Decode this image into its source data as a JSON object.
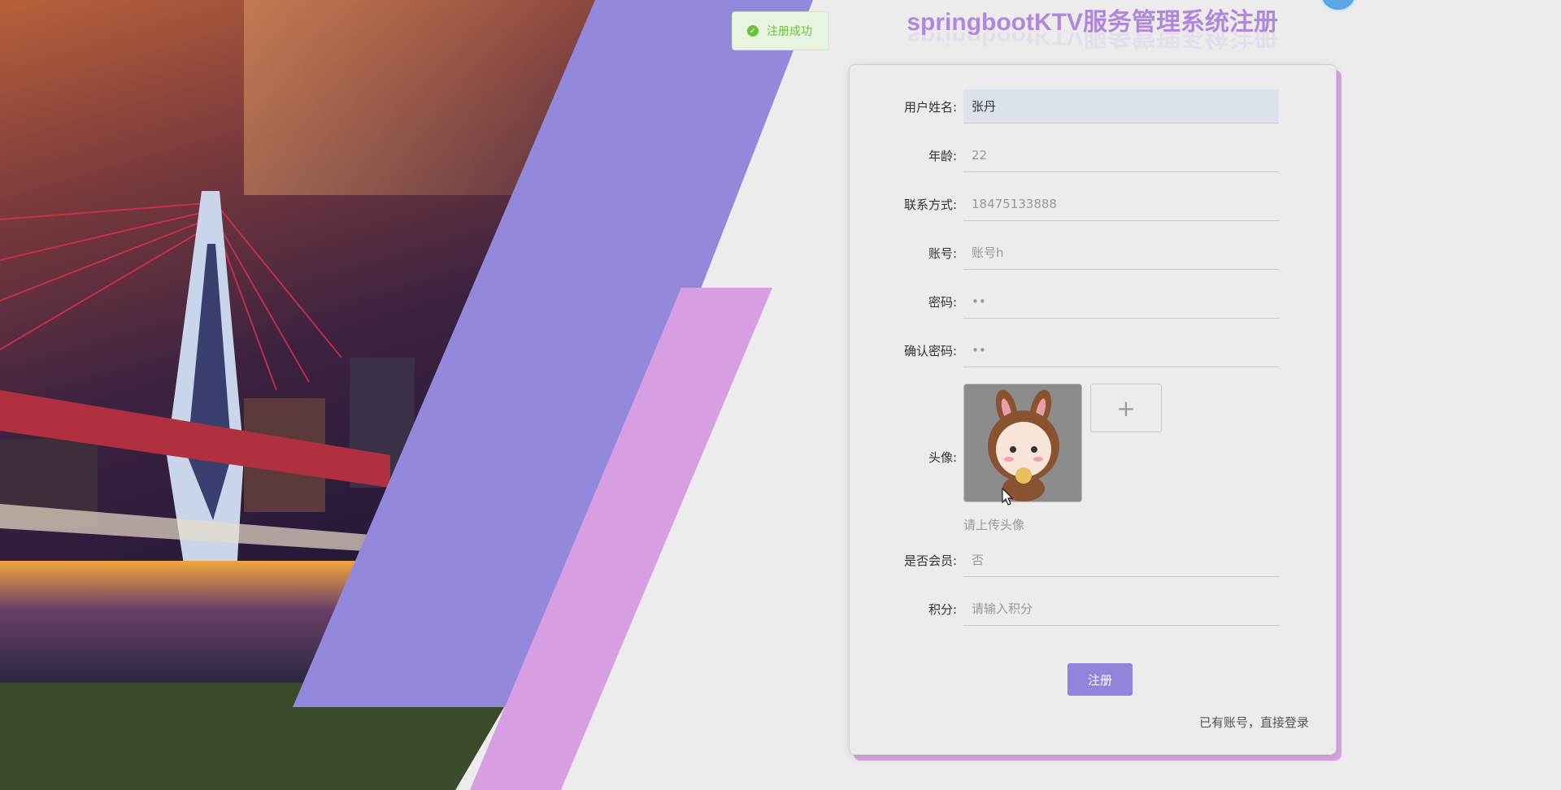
{
  "toast": {
    "message": "注册成功",
    "icon": "check-circle-icon",
    "color": "#67c23a"
  },
  "header": {
    "title": "springbootKTV服务管理系统注册"
  },
  "form": {
    "name": {
      "label": "用户姓名:",
      "value": "张丹"
    },
    "age": {
      "label": "年龄:",
      "value": "22"
    },
    "phone": {
      "label": "联系方式:",
      "value": "18475133888"
    },
    "account": {
      "label": "账号:",
      "value": "账号h"
    },
    "password": {
      "label": "密码:",
      "value": "••"
    },
    "confirm": {
      "label": "确认密码:",
      "value": "••"
    },
    "avatar": {
      "label": "头像:",
      "hint": "请上传头像",
      "add_symbol": "+"
    },
    "member": {
      "label": "是否会员:",
      "value": "否"
    },
    "points": {
      "label": "积分:",
      "placeholder": "请输入积分"
    },
    "submit_label": "注册",
    "login_link": "已有账号，直接登录"
  },
  "colors": {
    "accent": "#8f86db",
    "band_purple": "#9389dc",
    "band_pink": "#d79ee1"
  }
}
